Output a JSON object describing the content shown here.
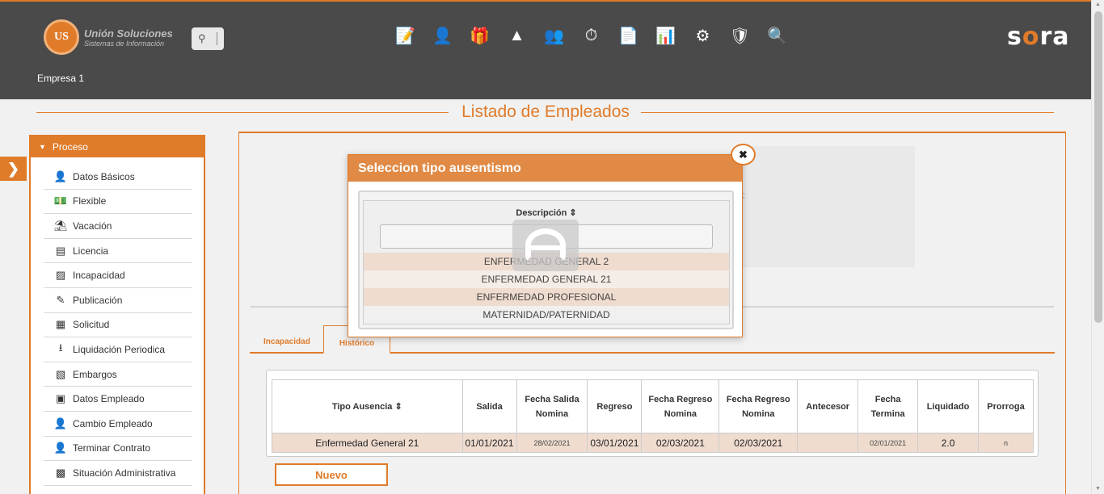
{
  "header": {
    "logo_mark": "US",
    "logo_line1": "Unión Soluciones",
    "logo_line2": "Sistemas de Información",
    "brand": "sora",
    "company": "Empresa 1",
    "module_icons": [
      "form-edit-icon",
      "person-medical-icon",
      "gift-icon",
      "org-chart-icon",
      "person-board-icon",
      "stopwatch-icon",
      "document-list-icon",
      "presentation-icon",
      "gears-icon",
      "medkit-shield-icon",
      "person-search-icon"
    ]
  },
  "page": {
    "title": "Listado de Empleados"
  },
  "sidebar": {
    "section": "Proceso",
    "items": [
      {
        "label": "Datos Básicos",
        "icon": "person-icon"
      },
      {
        "label": "Flexible",
        "icon": "money-icon"
      },
      {
        "label": "Vacación",
        "icon": "beach-chair-icon"
      },
      {
        "label": "Licencia",
        "icon": "list-document-icon"
      },
      {
        "label": "Incapacidad",
        "icon": "medical-file-icon"
      },
      {
        "label": "Publicación",
        "icon": "pencil-icon"
      },
      {
        "label": "Solicitud",
        "icon": "form-icon"
      },
      {
        "label": "Liquidación Periodica",
        "icon": "download-icon"
      },
      {
        "label": "Embargos",
        "icon": "calculator-icon"
      },
      {
        "label": "Datos Empleado",
        "icon": "id-card-icon"
      },
      {
        "label": "Cambio Empleado",
        "icon": "person-plus-icon"
      },
      {
        "label": "Terminar Contrato",
        "icon": "person-remove-icon"
      },
      {
        "label": "Situación Administrativa",
        "icon": "file-user-icon"
      }
    ]
  },
  "tabs": {
    "incapacidad": "Incapacidad",
    "historico": "Histórico"
  },
  "table": {
    "columns": [
      "Tipo Ausencia",
      "Salida",
      "Fecha Salida Nomina",
      "Regreso",
      "Fecha Regreso Nomina",
      "Fecha Regreso Nomina",
      "Antecesor",
      "Fecha Termina",
      "Liquidado",
      "Prorroga"
    ],
    "rows": [
      [
        "Enfermedad General 21",
        "01/01/2021",
        "28/02/2021",
        "03/01/2021",
        "02/03/2021",
        "02/03/2021",
        "",
        "02/01/2021",
        "2.0",
        "n"
      ]
    ]
  },
  "buttons": {
    "nuevo": "Nuevo"
  },
  "modal": {
    "title": "Seleccion tipo ausentismo",
    "column_header": "Descripción",
    "filter_value": "",
    "options": [
      "ENFERMEDAD GENERAL 2",
      "ENFERMEDAD GENERAL 21",
      "ENFERMEDAD PROFESIONAL",
      "MATERNIDAD/PATERNIDAD"
    ]
  },
  "colors": {
    "accent": "#e07b2a",
    "header_bg": "#4a4a4a",
    "row_highlight": "#efdccf"
  }
}
